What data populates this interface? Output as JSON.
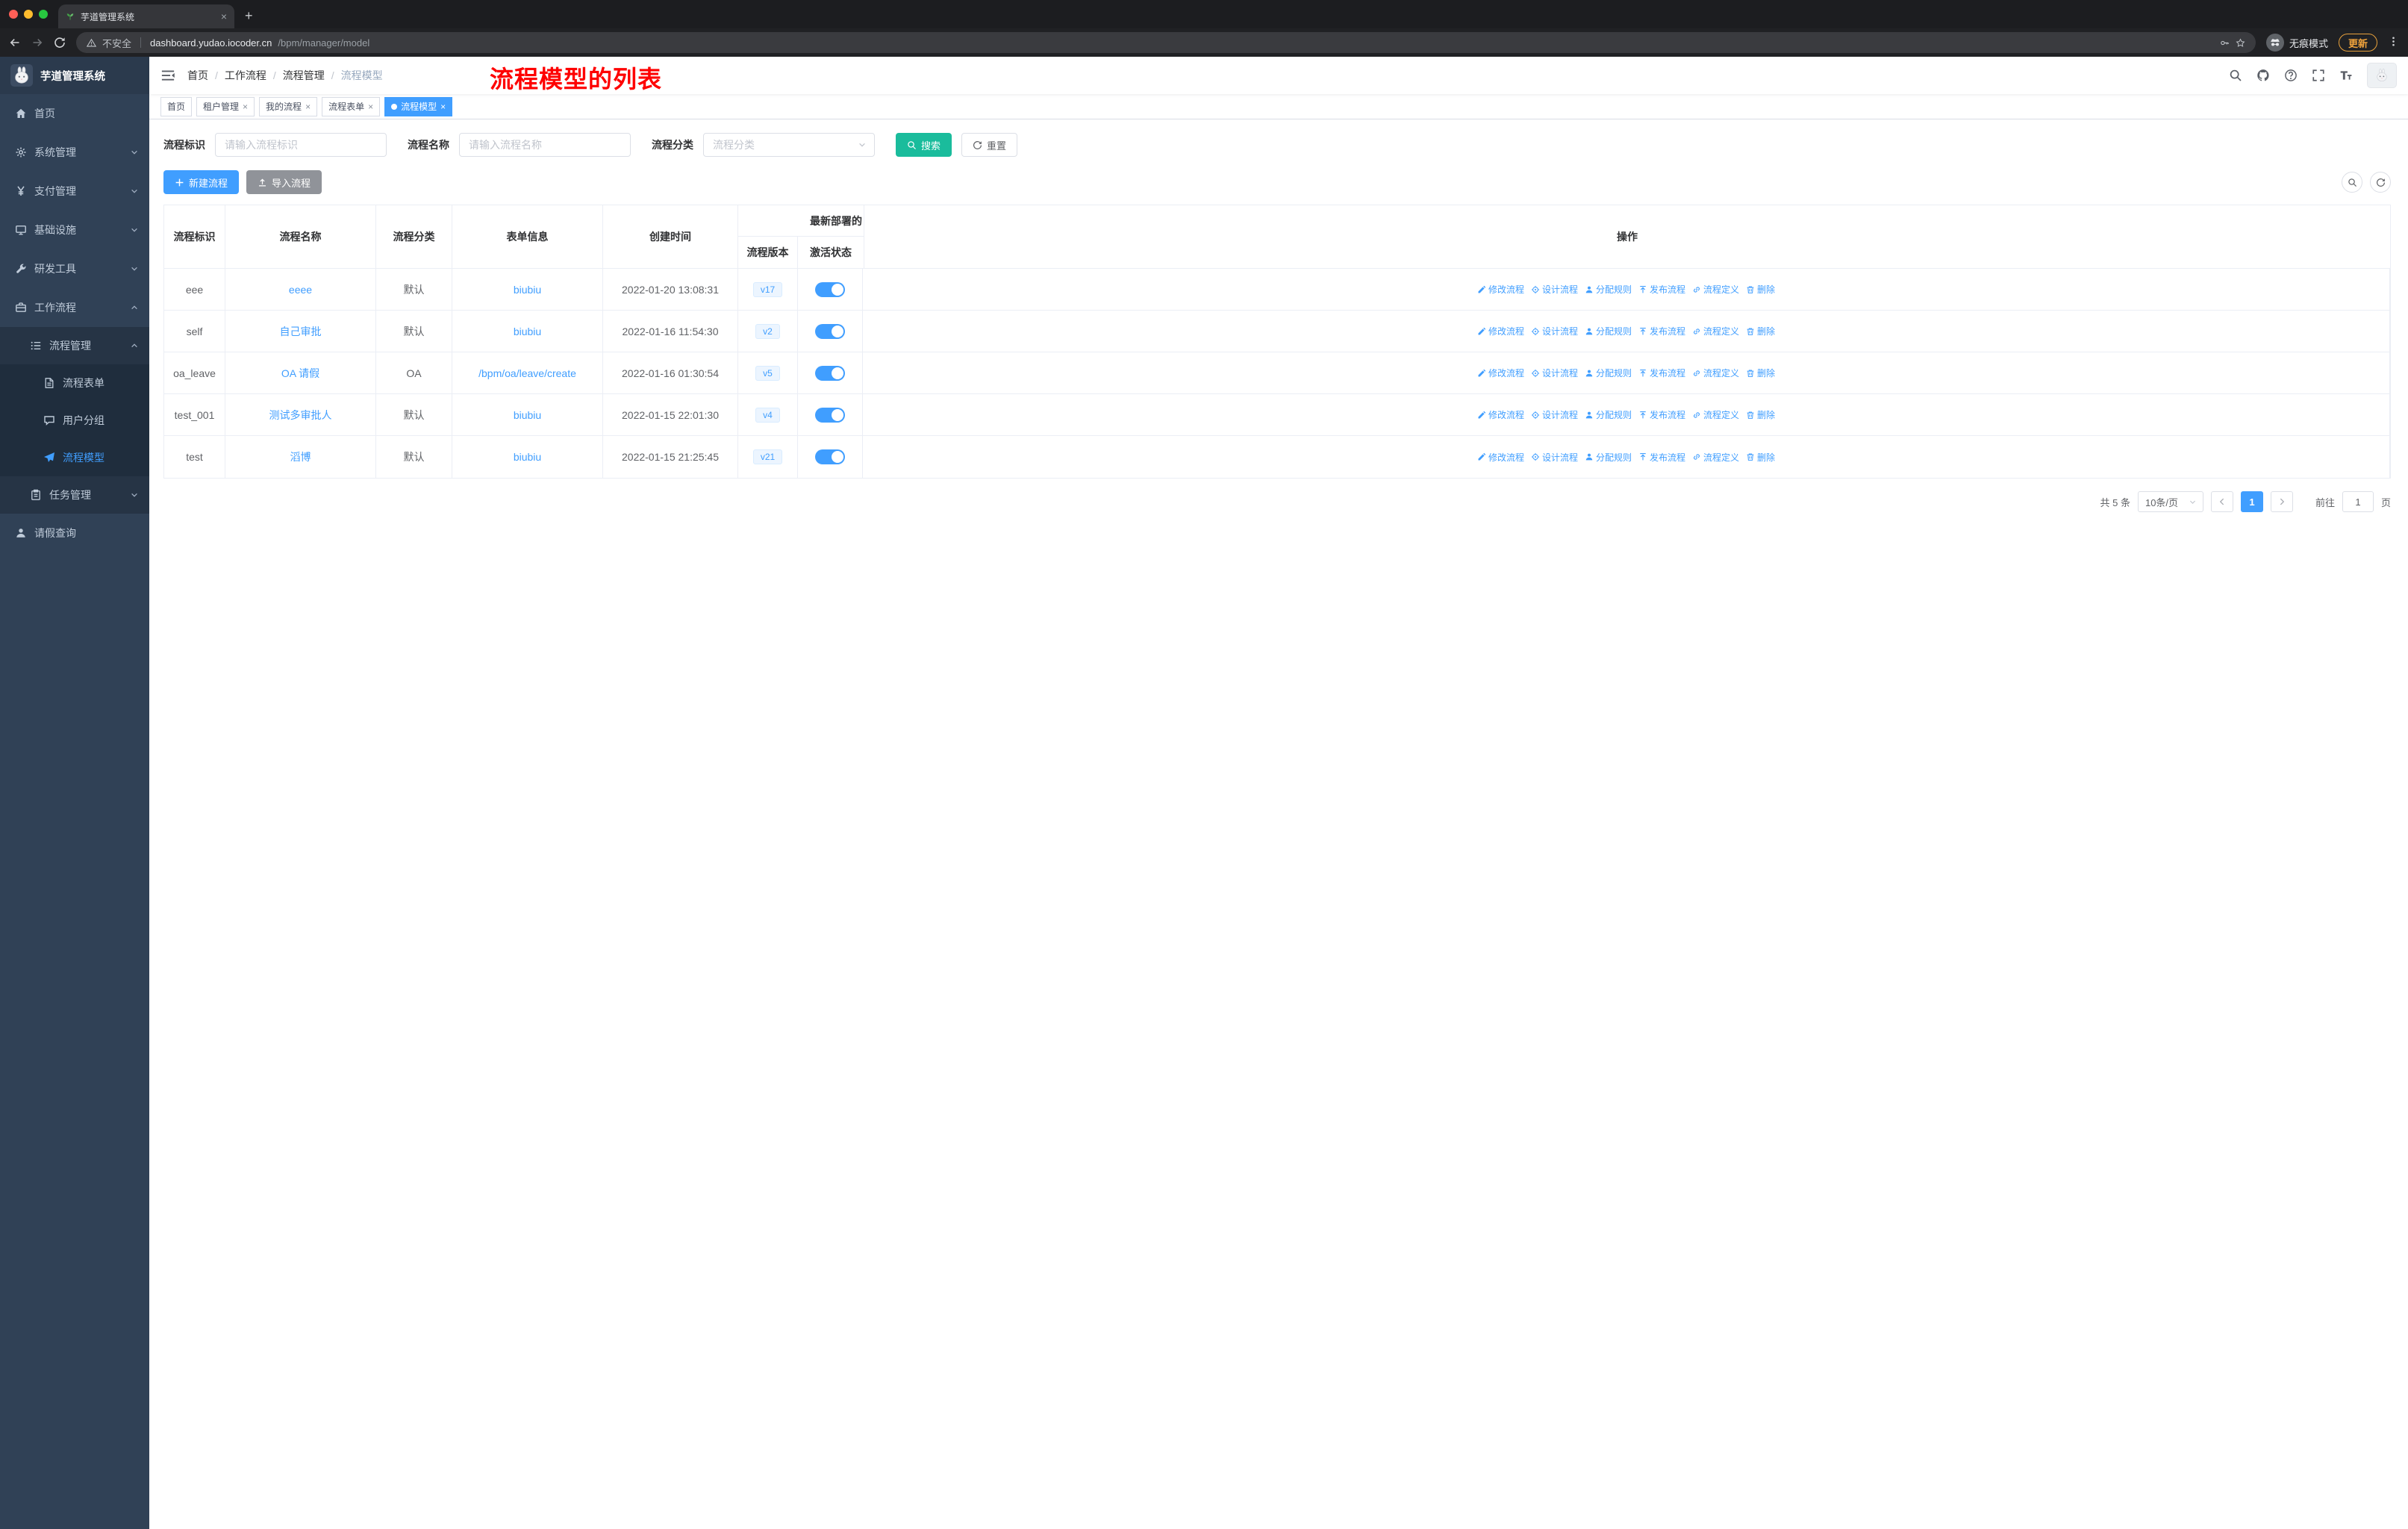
{
  "browser": {
    "tab_title": "芋道管理系统",
    "new_tab_label": "+",
    "security_label": "不安全",
    "url_host": "dashboard.yudao.iocoder.cn",
    "url_path": "/bpm/manager/model",
    "incognito_label": "无痕模式",
    "update_label": "更新"
  },
  "sidebar": {
    "logo_title": "芋道管理系统",
    "items": [
      {
        "id": "home",
        "label": "首页",
        "icon": "home-icon",
        "level": 1
      },
      {
        "id": "system",
        "label": "系统管理",
        "icon": "gear-icon",
        "level": 1,
        "arrow": "down"
      },
      {
        "id": "payment",
        "label": "支付管理",
        "icon": "yen-icon",
        "level": 1,
        "arrow": "down"
      },
      {
        "id": "infrastructure",
        "label": "基础设施",
        "icon": "monitor-icon",
        "level": 1,
        "arrow": "down"
      },
      {
        "id": "devtools",
        "label": "研发工具",
        "icon": "wrench-icon",
        "level": 1,
        "arrow": "down"
      },
      {
        "id": "workflow",
        "label": "工作流程",
        "icon": "briefcase-icon",
        "level": 1,
        "arrow": "up"
      },
      {
        "id": "process-mgmt",
        "label": "流程管理",
        "icon": "list-icon",
        "level": 2,
        "arrow": "up"
      },
      {
        "id": "process-form",
        "label": "流程表单",
        "icon": "doc-icon",
        "level": 3
      },
      {
        "id": "user-group",
        "label": "用户分组",
        "icon": "chat-icon",
        "level": 3
      },
      {
        "id": "process-model",
        "label": "流程模型",
        "icon": "send-icon",
        "level": 3,
        "active": true
      },
      {
        "id": "task-mgmt",
        "label": "任务管理",
        "icon": "clipboard-icon",
        "level": 2,
        "arrow": "down"
      },
      {
        "id": "leave-query",
        "label": "请假查询",
        "icon": "user-icon",
        "level": 1
      }
    ]
  },
  "header": {
    "breadcrumb": [
      "首页",
      "工作流程",
      "流程管理",
      "流程模型"
    ],
    "annotation": "流程模型的列表"
  },
  "tags": [
    {
      "id": "home",
      "label": "首页"
    },
    {
      "id": "tenant",
      "label": "租户管理",
      "closable": true
    },
    {
      "id": "my-process",
      "label": "我的流程",
      "closable": true
    },
    {
      "id": "process-form",
      "label": "流程表单",
      "closable": true
    },
    {
      "id": "process-model",
      "label": "流程模型",
      "closable": true,
      "active": true
    }
  ],
  "filters": {
    "key_label": "流程标识",
    "key_placeholder": "请输入流程标识",
    "name_label": "流程名称",
    "name_placeholder": "请输入流程名称",
    "category_label": "流程分类",
    "category_placeholder": "流程分类",
    "search_label": "搜索",
    "reset_label": "重置"
  },
  "toolbar": {
    "create_label": "新建流程",
    "import_label": "导入流程"
  },
  "table": {
    "group_header": "最新部署的",
    "columns": {
      "key": "流程标识",
      "name": "流程名称",
      "category": "流程分类",
      "form": "表单信息",
      "created": "创建时间",
      "version": "流程版本",
      "status": "激活状态",
      "ops": "操作"
    },
    "rows": [
      {
        "key": "eee",
        "name": "eeee",
        "category": "默认",
        "form": "biubiu",
        "created": "2022-01-20 13:08:31",
        "version": "v17",
        "active": true
      },
      {
        "key": "self",
        "name": "自己审批",
        "category": "默认",
        "form": "biubiu",
        "created": "2022-01-16 11:54:30",
        "version": "v2",
        "active": true
      },
      {
        "key": "oa_leave",
        "name": "OA 请假",
        "category": "OA",
        "form": "/bpm/oa/leave/create",
        "created": "2022-01-16 01:30:54",
        "version": "v5",
        "active": true
      },
      {
        "key": "test_001",
        "name": "测试多审批人",
        "category": "默认",
        "form": "biubiu",
        "created": "2022-01-15 22:01:30",
        "version": "v4",
        "active": true
      },
      {
        "key": "test",
        "name": "滔博",
        "category": "默认",
        "form": "biubiu",
        "created": "2022-01-15 21:25:45",
        "version": "v21",
        "active": true
      }
    ],
    "actions": [
      {
        "id": "modify",
        "label": "修改流程",
        "icon": "edit-icon"
      },
      {
        "id": "design",
        "label": "设计流程",
        "icon": "design-icon"
      },
      {
        "id": "assign",
        "label": "分配规则",
        "icon": "assign-icon"
      },
      {
        "id": "publish",
        "label": "发布流程",
        "icon": "publish-icon"
      },
      {
        "id": "definition",
        "label": "流程定义",
        "icon": "link-icon"
      },
      {
        "id": "delete",
        "label": "删除",
        "icon": "delete-icon"
      }
    ]
  },
  "pagination": {
    "total": "共 5 条",
    "page_size": "10条/页",
    "current_page": "1",
    "goto_label": "前往",
    "goto_value": "1",
    "page_unit": "页"
  },
  "colors": {
    "accent": "#409eff",
    "search_button": "#1abc9c",
    "annotation_red": "#fe0000",
    "sidebar_bg": "#304156",
    "sidebar_submenu_bg": "#1f2d3d",
    "table_border": "#ebeef5",
    "version_tag_bg": "#ecf5ff"
  }
}
